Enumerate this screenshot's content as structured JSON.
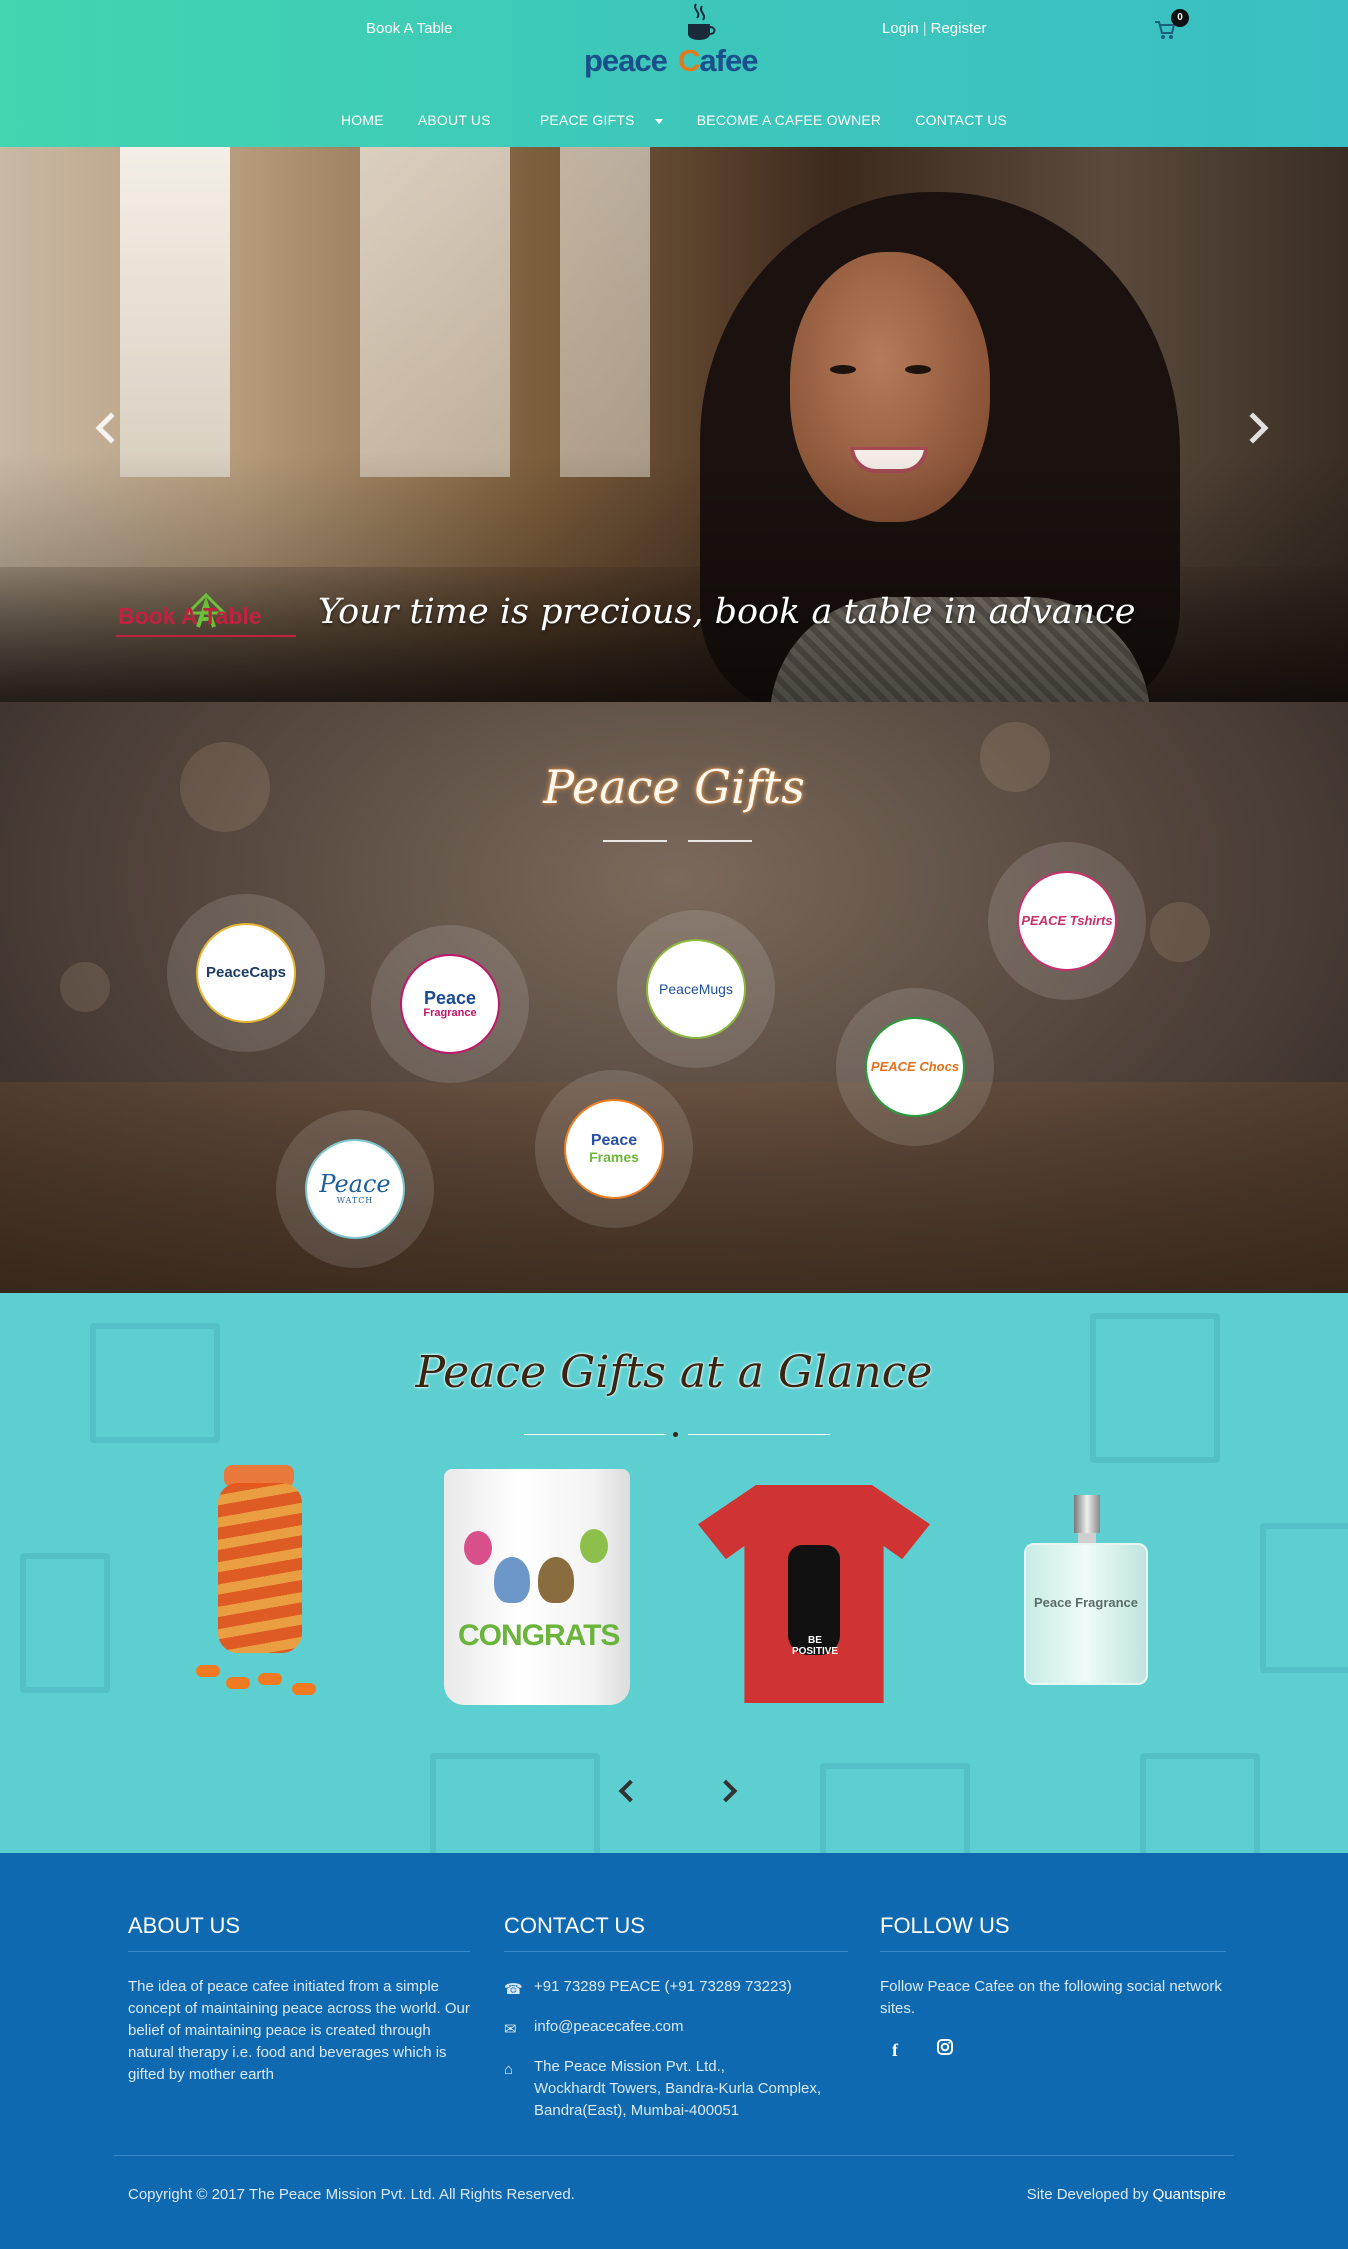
{
  "header": {
    "book_link": "Book A Table",
    "logo_word1": "peace",
    "logo_word2_c": "C",
    "logo_word2_rest": "afee",
    "login": "Login",
    "separator": "|",
    "register": "Register",
    "cart_count": "0",
    "cart_icon": "shopping-cart-icon"
  },
  "nav": {
    "items": [
      "HOME",
      "ABOUT US",
      "PEACE GIFTS",
      "BECOME A CAFEE OWNER",
      "CONTACT US"
    ]
  },
  "hero": {
    "logo_text": "Book A Table",
    "caption": "Your time is precious, book a table in advance"
  },
  "gifts": {
    "title": "Peace Gifts",
    "brands": [
      {
        "name": "PeaceCaps"
      },
      {
        "name": "Peace",
        "sub": "Fragrance"
      },
      {
        "name": "PeaceMugs"
      },
      {
        "name": "PEACE Tshirts"
      },
      {
        "name": "PEACE Chocs"
      },
      {
        "name": "Peace",
        "sub": "Frames"
      },
      {
        "name": "Peace",
        "sub": "WATCH"
      }
    ]
  },
  "glance": {
    "title": "Peace Gifts at a Glance",
    "mug_text": "CONGRATS",
    "tee_text": "BE POSITIVE",
    "perfume_text": "Peace Fragrance"
  },
  "footer": {
    "about": {
      "heading": "ABOUT US",
      "text": "The idea of peace cafee initiated from a simple concept of maintaining peace across the world. Our belief of maintaining peace is created through natural therapy i.e. food and beverages which is gifted by mother earth"
    },
    "contact": {
      "heading": "CONTACT US",
      "phone": "+91 73289 PEACE (+91 73289 73223)",
      "email": "info@peacecafee.com",
      "address_line1": "The Peace Mission Pvt. Ltd.,",
      "address_line2": "Wockhardt Towers, Bandra-Kurla Complex,",
      "address_line3": "Bandra(East), Mumbai-400051"
    },
    "follow": {
      "heading": "FOLLOW US",
      "text": "Follow Peace Cafee on the following social network sites.",
      "icons": [
        "facebook-icon",
        "instagram-icon"
      ]
    },
    "copyright": "Copyright © 2017 The Peace Mission Pvt. Ltd. All Rights Reserved.",
    "dev_prefix": "Site Developed by",
    "dev_name": "Quantspire"
  },
  "colors": {
    "header_start": "#42d5b0",
    "header_end": "#3bbfc4",
    "glance_bg": "#5ecfd1",
    "footer_bg": "#0f69b0",
    "brand_red": "#c0233f"
  }
}
